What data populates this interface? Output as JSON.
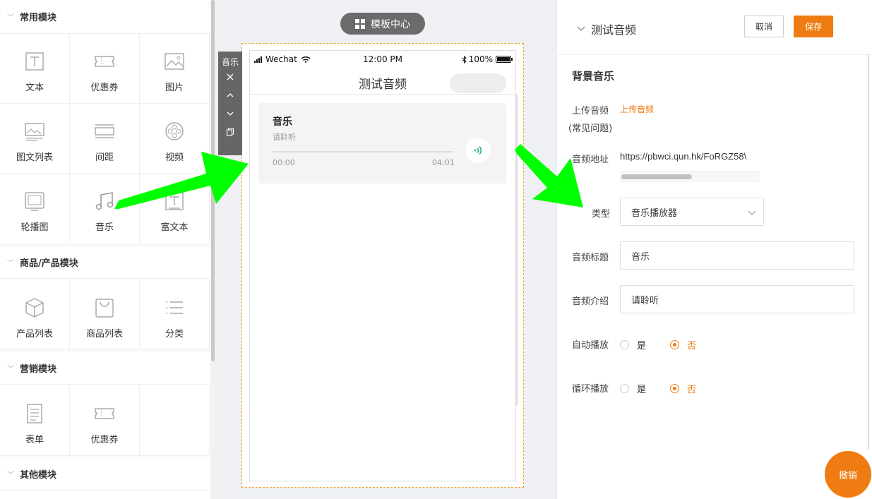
{
  "left_panel": {
    "sections": [
      {
        "title": "常用模块",
        "items": [
          {
            "label": "文本",
            "icon": "text-icon"
          },
          {
            "label": "优惠券",
            "icon": "coupon-icon"
          },
          {
            "label": "图片",
            "icon": "image-icon"
          },
          {
            "label": "图文列表",
            "icon": "image-text-list-icon"
          },
          {
            "label": "间距",
            "icon": "spacing-icon"
          },
          {
            "label": "视频",
            "icon": "video-icon"
          },
          {
            "label": "轮播图",
            "icon": "carousel-icon"
          },
          {
            "label": "音乐",
            "icon": "music-icon"
          },
          {
            "label": "富文本",
            "icon": "rich-text-icon"
          }
        ]
      },
      {
        "title": "商品/产品模块",
        "items": [
          {
            "label": "产品列表",
            "icon": "product-list-icon"
          },
          {
            "label": "商品列表",
            "icon": "shopping-bag-icon"
          },
          {
            "label": "分类",
            "icon": "category-icon"
          }
        ]
      },
      {
        "title": "营销模块",
        "items": [
          {
            "label": "表单",
            "icon": "form-icon"
          },
          {
            "label": "优惠券",
            "icon": "coupon-icon"
          }
        ]
      },
      {
        "title": "其他模块",
        "items": []
      }
    ]
  },
  "center": {
    "template_button": "模板中心",
    "status_bar": {
      "carrier": "Wechat",
      "time": "12:00 PM",
      "battery": "100%"
    },
    "page_title": "测试音频",
    "music_card": {
      "title": "音乐",
      "desc": "请聆听",
      "start": "00:00",
      "end": "04:01"
    },
    "toolbar": {
      "label": "音乐"
    }
  },
  "right_panel": {
    "title": "测试音频",
    "cancel": "取消",
    "save": "保存",
    "section_title": "背景音乐",
    "upload_label": "上传音频",
    "upload_link": "上传音频",
    "faq": "(常见问题)",
    "url_label": "音频地址",
    "url_value": "https://pbwci.qun.hk/FoRGZ58\\",
    "type_label": "类型",
    "type_value": "音乐播放器",
    "audio_title_label": "音频标题",
    "audio_title_value": "音乐",
    "audio_desc_label": "音频介绍",
    "audio_desc_value": "请聆听",
    "autoplay_label": "自动播放",
    "loop_label": "循环播放",
    "yes": "是",
    "no": "否"
  },
  "undo_button": "撤销",
  "colors": {
    "accent": "#ee7c12",
    "annotation": "#00ff00",
    "play": "#22b573"
  }
}
